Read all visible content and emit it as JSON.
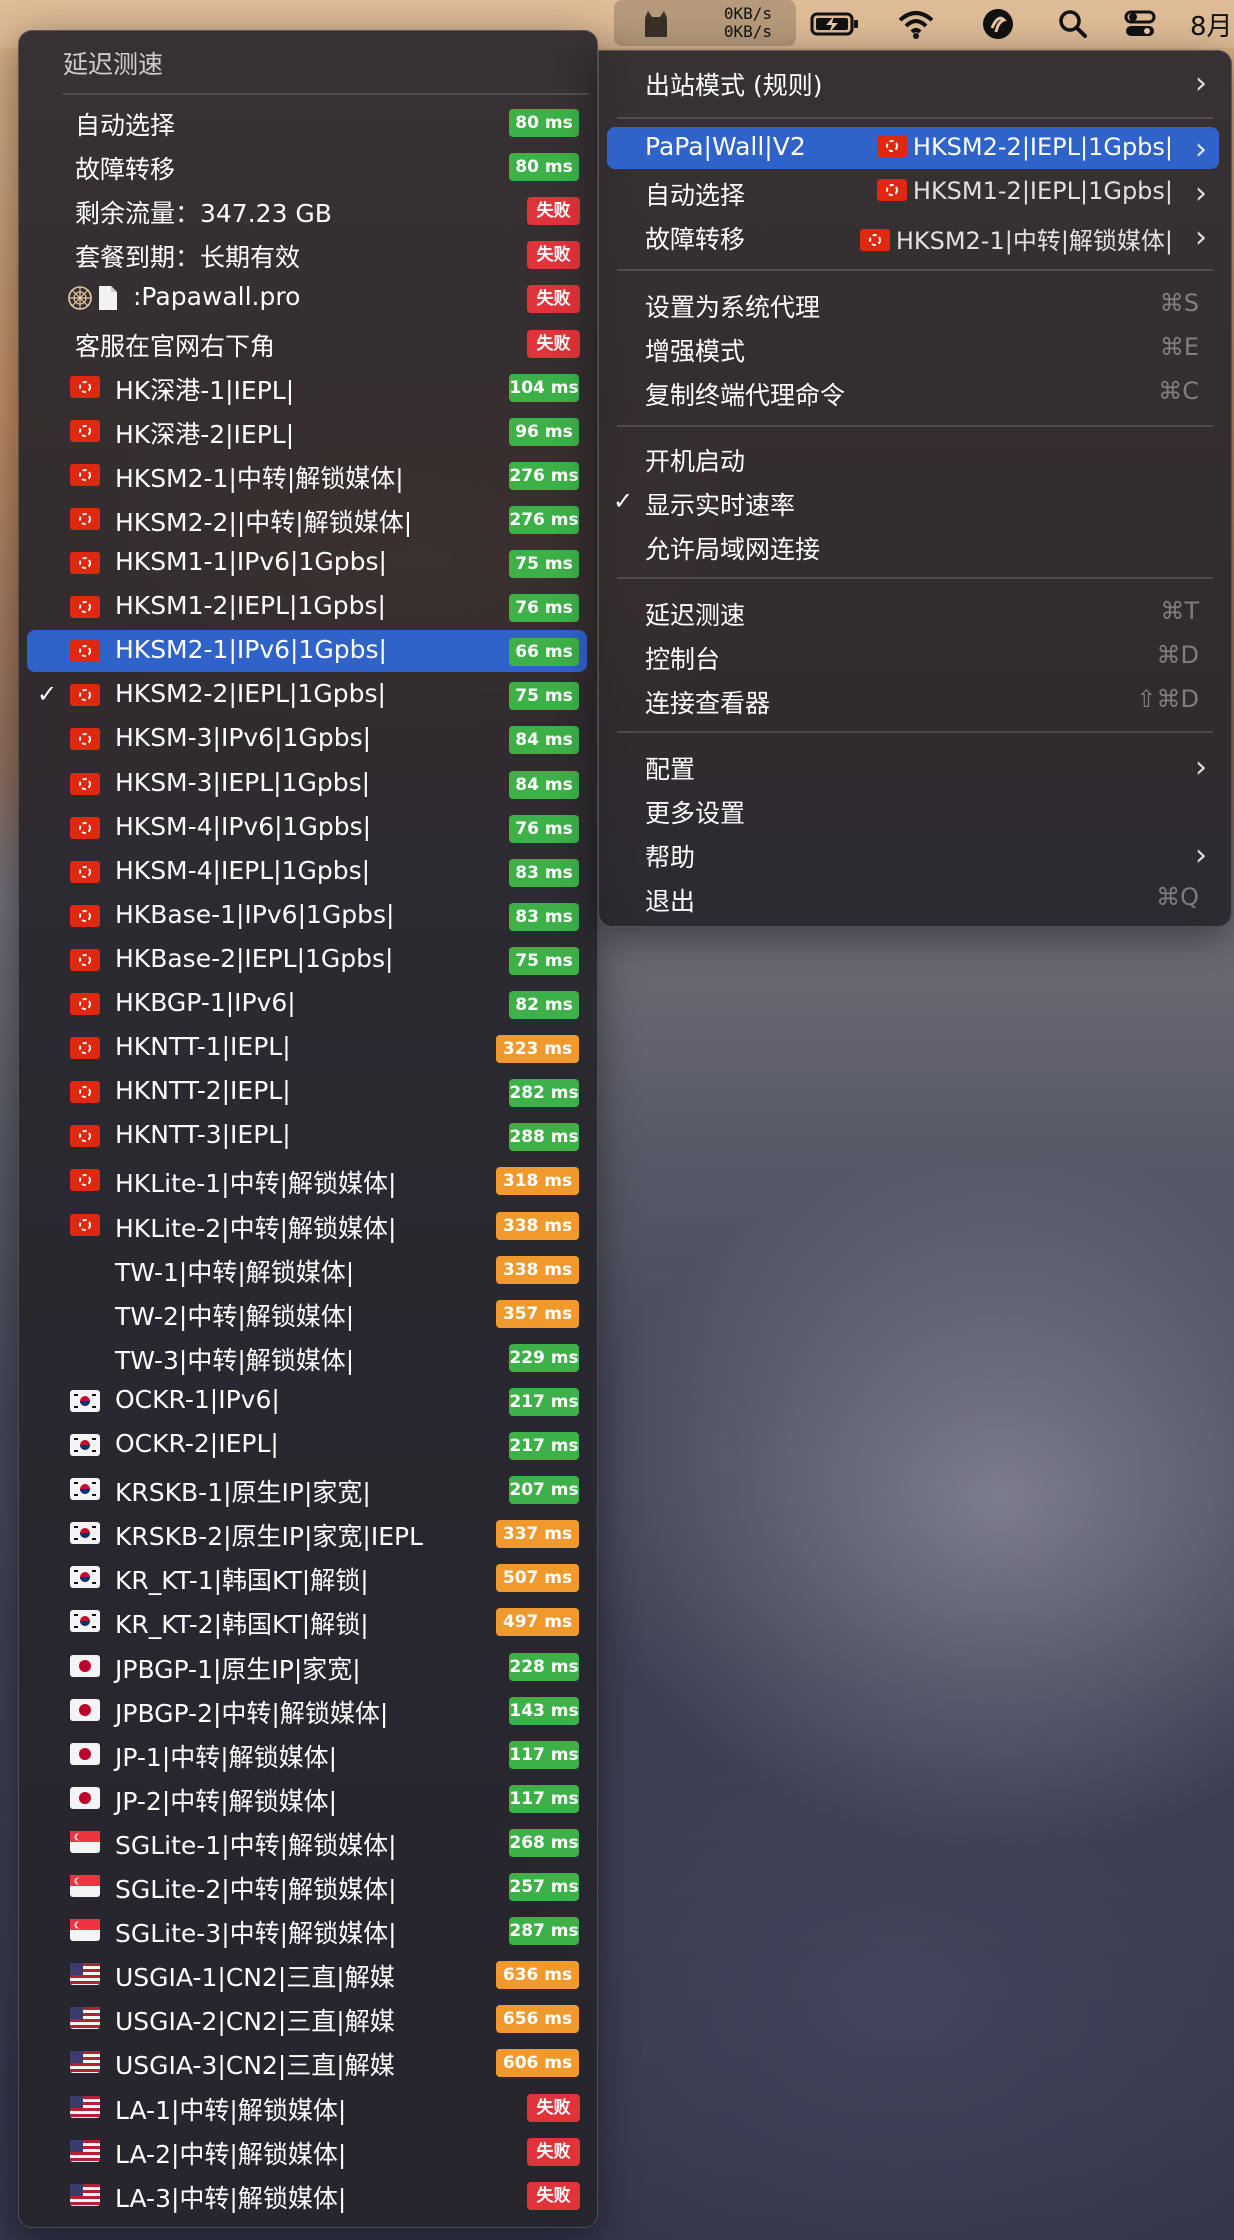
{
  "menubar": {
    "upload_speed": "0KB/s",
    "download_speed": "0KB/s",
    "clock_partial": "8月"
  },
  "left_menu": {
    "title": "延迟测速",
    "items": [
      {
        "label": "自动选择",
        "latency": "80 ms",
        "color": "green"
      },
      {
        "label": "故障转移",
        "latency": "80 ms",
        "color": "green"
      },
      {
        "label": "剩余流量：347.23 GB",
        "latency": "失败",
        "color": "red"
      },
      {
        "label": "套餐到期：长期有效",
        "latency": "失败",
        "color": "red"
      },
      {
        "label": ":Papawall.pro",
        "latency": "失败",
        "color": "red",
        "icons": [
          "web-icon",
          "document-icon"
        ]
      },
      {
        "label": "客服在官网右下角",
        "latency": "失败",
        "color": "red"
      },
      {
        "label": "HK深港-1|IEPL|",
        "latency": "104 ms",
        "color": "green",
        "flag": "hk"
      },
      {
        "label": "HK深港-2|IEPL|",
        "latency": "96 ms",
        "color": "green",
        "flag": "hk"
      },
      {
        "label": "HKSM2-1|中转|解锁媒体|",
        "latency": "276 ms",
        "color": "green",
        "flag": "hk"
      },
      {
        "label": "HKSM2-2||中转|解锁媒体|",
        "latency": "276 ms",
        "color": "green",
        "flag": "hk"
      },
      {
        "label": "HKSM1-1|IPv6|1Gpbs|",
        "latency": "75 ms",
        "color": "green",
        "flag": "hk"
      },
      {
        "label": "HKSM1-2|IEPL|1Gpbs|",
        "latency": "76 ms",
        "color": "green",
        "flag": "hk"
      },
      {
        "label": "HKSM2-1|IPv6|1Gpbs|",
        "latency": "66 ms",
        "color": "green",
        "flag": "hk",
        "selected": true
      },
      {
        "label": "HKSM2-2|IEPL|1Gpbs|",
        "latency": "75 ms",
        "color": "green",
        "flag": "hk",
        "checked": true
      },
      {
        "label": "HKSM-3|IPv6|1Gpbs|",
        "latency": "84 ms",
        "color": "green",
        "flag": "hk"
      },
      {
        "label": "HKSM-3|IEPL|1Gpbs|",
        "latency": "84 ms",
        "color": "green",
        "flag": "hk"
      },
      {
        "label": "HKSM-4|IPv6|1Gpbs|",
        "latency": "76 ms",
        "color": "green",
        "flag": "hk"
      },
      {
        "label": "HKSM-4|IEPL|1Gpbs|",
        "latency": "83 ms",
        "color": "green",
        "flag": "hk"
      },
      {
        "label": "HKBase-1|IPv6|1Gpbs|",
        "latency": "83 ms",
        "color": "green",
        "flag": "hk"
      },
      {
        "label": "HKBase-2|IEPL|1Gpbs|",
        "latency": "75 ms",
        "color": "green",
        "flag": "hk"
      },
      {
        "label": "HKBGP-1|IPv6|",
        "latency": "82 ms",
        "color": "green",
        "flag": "hk"
      },
      {
        "label": "HKNTT-1|IEPL|",
        "latency": "323 ms",
        "color": "orange",
        "flag": "hk"
      },
      {
        "label": "HKNTT-2|IEPL|",
        "latency": "282 ms",
        "color": "green",
        "flag": "hk"
      },
      {
        "label": "HKNTT-3|IEPL|",
        "latency": "288 ms",
        "color": "green",
        "flag": "hk"
      },
      {
        "label": "HKLite-1|中转|解锁媒体|",
        "latency": "318 ms",
        "color": "orange",
        "flag": "hk"
      },
      {
        "label": "HKLite-2|中转|解锁媒体|",
        "latency": "338 ms",
        "color": "orange",
        "flag": "hk"
      },
      {
        "label": "TW-1|中转|解锁媒体|",
        "latency": "338 ms",
        "color": "orange"
      },
      {
        "label": "TW-2|中转|解锁媒体|",
        "latency": "357 ms",
        "color": "orange"
      },
      {
        "label": "TW-3|中转|解锁媒体|",
        "latency": "229 ms",
        "color": "green"
      },
      {
        "label": "OCKR-1|IPv6|",
        "latency": "217 ms",
        "color": "green",
        "flag": "kr"
      },
      {
        "label": "OCKR-2|IEPL|",
        "latency": "217 ms",
        "color": "green",
        "flag": "kr"
      },
      {
        "label": "KRSKB-1|原生IP|家宽|",
        "latency": "207 ms",
        "color": "green",
        "flag": "kr"
      },
      {
        "label": "KRSKB-2|原生IP|家宽|IEPL",
        "latency": "337 ms",
        "color": "orange",
        "flag": "kr"
      },
      {
        "label": "KR_KT-1|韩国KT|解锁|",
        "latency": "507 ms",
        "color": "orange",
        "flag": "kr"
      },
      {
        "label": "KR_KT-2|韩国KT|解锁|",
        "latency": "497 ms",
        "color": "orange",
        "flag": "kr"
      },
      {
        "label": "JPBGP-1|原生IP|家宽|",
        "latency": "228 ms",
        "color": "green",
        "flag": "jp"
      },
      {
        "label": "JPBGP-2|中转|解锁媒体|",
        "latency": "143 ms",
        "color": "green",
        "flag": "jp"
      },
      {
        "label": "JP-1|中转|解锁媒体|",
        "latency": "117 ms",
        "color": "green",
        "flag": "jp"
      },
      {
        "label": "JP-2|中转|解锁媒体|",
        "latency": "117 ms",
        "color": "green",
        "flag": "jp"
      },
      {
        "label": "SGLite-1|中转|解锁媒体|",
        "latency": "268 ms",
        "color": "green",
        "flag": "sg"
      },
      {
        "label": "SGLite-2|中转|解锁媒体|",
        "latency": "257 ms",
        "color": "green",
        "flag": "sg"
      },
      {
        "label": "SGLite-3|中转|解锁媒体|",
        "latency": "287 ms",
        "color": "green",
        "flag": "sg"
      },
      {
        "label": "USGIA-1|CN2|三直|解媒",
        "latency": "636 ms",
        "color": "orange",
        "flag": "us"
      },
      {
        "label": "USGIA-2|CN2|三直|解媒",
        "latency": "656 ms",
        "color": "orange",
        "flag": "us"
      },
      {
        "label": "USGIA-3|CN2|三直|解媒",
        "latency": "606 ms",
        "color": "orange",
        "flag": "us"
      },
      {
        "label": "LA-1|中转|解锁媒体|",
        "latency": "失败",
        "color": "red",
        "flag": "us"
      },
      {
        "label": "LA-2|中转|解锁媒体|",
        "latency": "失败",
        "color": "red",
        "flag": "us"
      },
      {
        "label": "LA-3|中转|解锁媒体|",
        "latency": "失败",
        "color": "red",
        "flag": "us"
      }
    ]
  },
  "right_menu": {
    "outbound_mode": {
      "label": "出站模式 (规则)"
    },
    "proxy_groups": [
      {
        "label": "PaPa|Wall|V2",
        "value": "HKSM2-2|IEPL|1Gpbs|",
        "flag": "hk",
        "selected": true
      },
      {
        "label": "自动选择",
        "value": "HKSM1-2|IEPL|1Gpbs|",
        "flag": "hk"
      },
      {
        "label": "故障转移",
        "value": "HKSM2-1|中转|解锁媒体|",
        "flag": "hk"
      }
    ],
    "system_proxy": {
      "label": "设置为系统代理",
      "shortcut": "⌘S"
    },
    "enhanced_mode": {
      "label": "增强模式",
      "shortcut": "⌘E"
    },
    "copy_terminal": {
      "label": "复制终端代理命令",
      "shortcut": "⌘C"
    },
    "launch_at_login": {
      "label": "开机启动"
    },
    "show_speed": {
      "label": "显示实时速率",
      "checked": true
    },
    "allow_lan": {
      "label": "允许局域网连接"
    },
    "latency_test": {
      "label": "延迟测速",
      "shortcut": "⌘T"
    },
    "dashboard": {
      "label": "控制台",
      "shortcut": "⌘D"
    },
    "conn_viewer": {
      "label": "连接查看器",
      "shortcut": "⇧⌘D"
    },
    "config": {
      "label": "配置"
    },
    "more_settings": {
      "label": "更多设置"
    },
    "help": {
      "label": "帮助"
    },
    "quit": {
      "label": "退出",
      "shortcut": "⌘Q"
    }
  },
  "colors": {
    "selection": "#2f63c9",
    "latency_good": "#3db148",
    "latency_slow": "#f09a2e",
    "latency_fail": "#e0333a"
  }
}
